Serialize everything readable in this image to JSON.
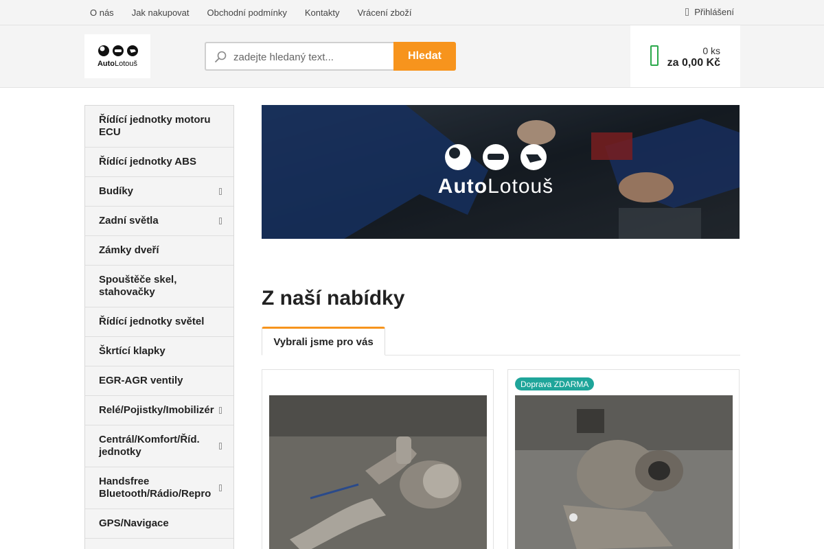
{
  "topnav": {
    "links": [
      "O nás",
      "Jak nakupovat",
      "Obchodní podmínky",
      "Kontakty",
      "Vrácení zboží"
    ],
    "login_label": "Přihlášení",
    "login_icon": "user-icon"
  },
  "logo": {
    "text_bold": "Auto",
    "text_light": "Lotouš"
  },
  "search": {
    "placeholder": "zadejte hledaný text...",
    "button_label": "Hledat",
    "icon": "search-icon"
  },
  "cart": {
    "count": "0 ks",
    "total": "za 0,00 Kč",
    "icon": "cart-icon",
    "icon_color": "#2aa84a"
  },
  "sidebar": {
    "categories": [
      {
        "label": "Řídící jednotky motoru ECU",
        "has_sub": false
      },
      {
        "label": "Řídící jednotky ABS",
        "has_sub": false
      },
      {
        "label": "Budíky",
        "has_sub": true
      },
      {
        "label": "Zadní světla",
        "has_sub": true
      },
      {
        "label": "Zámky dveří",
        "has_sub": false
      },
      {
        "label": "Spouštěče skel, stahovačky",
        "has_sub": false
      },
      {
        "label": "Řídící jednotky světel",
        "has_sub": false
      },
      {
        "label": "Škrtící klapky",
        "has_sub": false
      },
      {
        "label": "EGR-AGR ventily",
        "has_sub": false
      },
      {
        "label": "Relé/Pojistky/Imobilizér",
        "has_sub": true
      },
      {
        "label": "Centrál/Komfort/Říd. jednotky",
        "has_sub": true
      },
      {
        "label": "Handsfree Bluetooth/Rádio/Repro",
        "has_sub": true
      },
      {
        "label": "GPS/Navigace",
        "has_sub": false
      }
    ]
  },
  "banner": {
    "text_bold": "Auto",
    "text_light": "Lotouš"
  },
  "main": {
    "section_title": "Z naší nabídky",
    "tab_label": "Vybrali jsme pro vás",
    "products": [
      {
        "badge": ""
      },
      {
        "badge": "Doprava ZDARMA"
      }
    ]
  },
  "colors": {
    "accent": "#f7941d",
    "badge": "#1fa59a",
    "cart": "#2aa84a"
  }
}
